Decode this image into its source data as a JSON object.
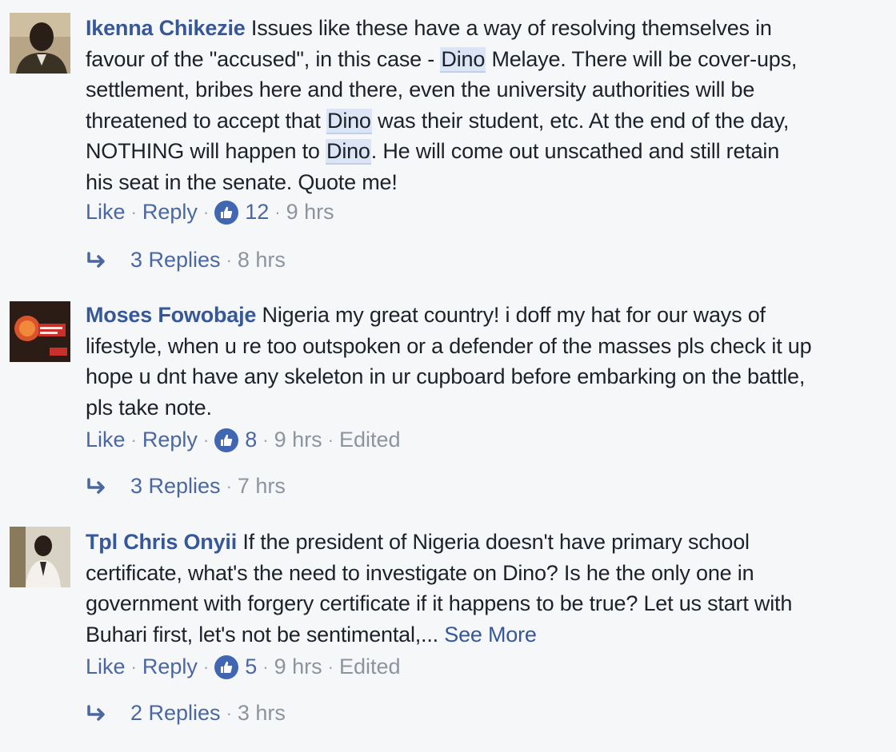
{
  "comments": [
    {
      "author": "Ikenna Chikezie",
      "lines": [
        [
          {
            "t": " Issues like these have a way of resolving themselves in"
          }
        ],
        [
          {
            "t": "favour of the \"accused\", in this case - "
          },
          {
            "t": "Dino",
            "hl": true
          },
          {
            "t": " Melaye. There will be cover-ups,"
          }
        ],
        [
          {
            "t": "settlement, bribes here and there, even the university authorities will be"
          }
        ],
        [
          {
            "t": "threatened to accept that "
          },
          {
            "t": "Dino",
            "hl": true
          },
          {
            "t": " was their student, etc. At the end of the day,"
          }
        ],
        [
          {
            "t": "NOTHING will happen to "
          },
          {
            "t": "Dino",
            "hl": true
          },
          {
            "t": ". He will come out unscathed and still retain"
          }
        ],
        [
          {
            "t": "his seat in the senate. Quote me!"
          }
        ]
      ],
      "actions": {
        "like": "Like",
        "reply": "Reply",
        "likes": "12",
        "time": "9 hrs",
        "edited": ""
      },
      "replies": {
        "label": "3 Replies",
        "time": "8 hrs"
      }
    },
    {
      "author": "Moses Fowobaje",
      "lines": [
        [
          {
            "t": " Nigeria my great country! i doff my hat for our ways of"
          }
        ],
        [
          {
            "t": "lifestyle, when u re too outspoken or a defender of the masses pls check it up"
          }
        ],
        [
          {
            "t": "hope u dnt have any skeleton in ur cupboard before embarking on the battle,"
          }
        ],
        [
          {
            "t": "pls take note."
          }
        ]
      ],
      "actions": {
        "like": "Like",
        "reply": "Reply",
        "likes": "8",
        "time": "9 hrs",
        "edited": "Edited"
      },
      "replies": {
        "label": "3 Replies",
        "time": "7 hrs"
      }
    },
    {
      "author": "Tpl Chris Onyii",
      "lines": [
        [
          {
            "t": " If the president of Nigeria doesn't have primary school"
          }
        ],
        [
          {
            "t": "certificate, what's the need to investigate on Dino? Is he the only one in"
          }
        ],
        [
          {
            "t": "government with forgery certificate if it happens to be true? Let us start with"
          }
        ],
        [
          {
            "t": "Buhari first, let's not be sentimental,... "
          },
          {
            "t": "See More",
            "more": true
          }
        ]
      ],
      "actions": {
        "like": "Like",
        "reply": "Reply",
        "likes": "5",
        "time": "9 hrs",
        "edited": "Edited"
      },
      "replies": {
        "label": "2 Replies",
        "time": "3 hrs"
      }
    }
  ],
  "separator": "·",
  "colors": {
    "author": "#365899",
    "link": "#4b67a1",
    "muted": "#8d949e",
    "highlight": "#dce5f5",
    "like_badge": "#4267b2"
  },
  "icons": {
    "like": "thumbs-up-icon",
    "reply_arrow": "reply-arrow-icon"
  }
}
